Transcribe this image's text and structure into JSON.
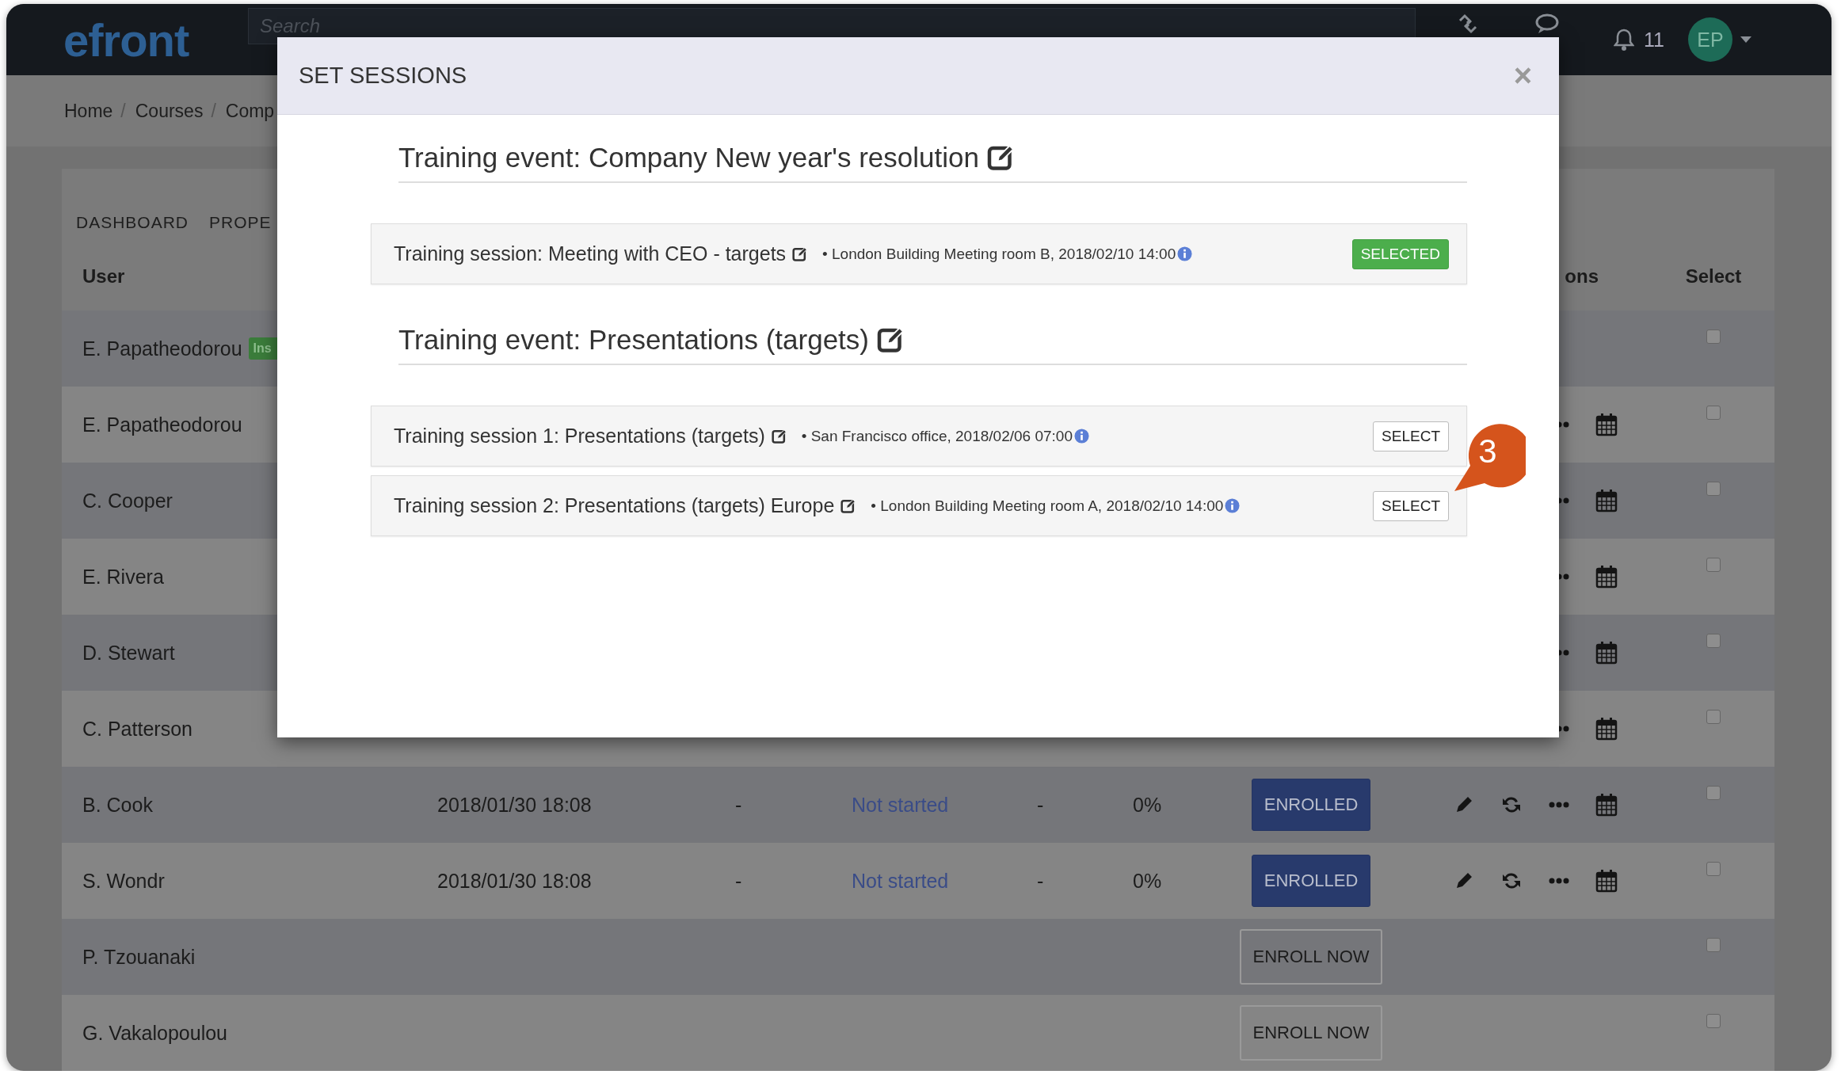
{
  "topbar": {
    "logo": "efront",
    "search": {
      "placeholder": "Search"
    },
    "notifications": "11",
    "avatar": "EP"
  },
  "breadcrumb": [
    {
      "label": "Home",
      "separator": "/"
    },
    {
      "label": "Courses",
      "separator": "/"
    },
    {
      "label": "Comp"
    }
  ],
  "tabs": [
    {
      "label": "DASHBOARD"
    },
    {
      "label": "PROPE"
    }
  ],
  "table": {
    "columns": [
      {
        "label": "User"
      },
      {
        "label": "ons"
      },
      {
        "label": "Select"
      }
    ],
    "rows": [
      {
        "name": "E. Papatheodorou",
        "badge": "Ins",
        "actions": [],
        "checked": false
      },
      {
        "name": "E. Papatheodorou",
        "actions": [
          {
            "kind": "more"
          },
          {
            "kind": "calendar"
          }
        ],
        "checked": false
      },
      {
        "name": "C. Cooper",
        "actions": [
          {
            "kind": "more"
          },
          {
            "kind": "calendar"
          }
        ],
        "checked": false
      },
      {
        "name": "E. Rivera",
        "actions": [
          {
            "kind": "more"
          },
          {
            "kind": "calendar"
          }
        ],
        "checked": false
      },
      {
        "name": "D. Stewart",
        "actions": [
          {
            "kind": "more"
          },
          {
            "kind": "calendar"
          }
        ],
        "checked": false
      },
      {
        "name": "C. Patterson",
        "actions": [
          {
            "kind": "more"
          },
          {
            "kind": "calendar"
          }
        ],
        "checked": false
      },
      {
        "name": "B. Cook",
        "column_2": "2018/01/30 18:08",
        "column_3": "-",
        "column_4": "Not started",
        "column_5": "-",
        "column_6": "0%",
        "enrollment": {
          "kind": "enrolled",
          "label": "ENROLLED"
        },
        "actions": [
          {
            "kind": "edit"
          },
          {
            "kind": "refresh"
          },
          {
            "kind": "more"
          },
          {
            "kind": "calendar"
          }
        ],
        "checked": false
      },
      {
        "name": "S. Wondr",
        "column_2": "2018/01/30 18:08",
        "column_3": "-",
        "column_4": "Not started",
        "column_5": "-",
        "column_6": "0%",
        "enrollment": {
          "kind": "enrolled",
          "label": "ENROLLED"
        },
        "actions": [
          {
            "kind": "edit"
          },
          {
            "kind": "refresh"
          },
          {
            "kind": "more"
          },
          {
            "kind": "calendar"
          }
        ],
        "checked": false
      },
      {
        "name": "P. Tzouanaki",
        "enrollment": {
          "kind": "enroll",
          "label": "ENROLL NOW"
        },
        "actions": [],
        "checked": false
      },
      {
        "name": "G. Vakalopoulou",
        "enrollment": {
          "kind": "enroll",
          "label": "ENROLL NOW"
        },
        "actions": [],
        "checked": false
      }
    ]
  },
  "modal": {
    "title": "SET SESSIONS",
    "close": "×",
    "events": [
      {
        "title": "Training event: Company New year's resolution",
        "sessions": [
          {
            "title": "Training session: Meeting with CEO - targets",
            "info": "• London Building Meeting room B, 2018/02/10 14:00",
            "button": "SELECTED",
            "selected": true
          }
        ]
      },
      {
        "title": "Training event: Presentations (targets)",
        "sessions": [
          {
            "title": "Training session 1: Presentations (targets)",
            "info": "• San Francisco office, 2018/02/06 07:00",
            "button": "SELECT",
            "selected": false
          },
          {
            "title": "Training session 2: Presentations (targets) Europe",
            "info": "• London Building Meeting room A, 2018/02/10 14:00",
            "button": "SELECT",
            "selected": false
          }
        ]
      }
    ]
  },
  "callout": {
    "label": "3"
  }
}
